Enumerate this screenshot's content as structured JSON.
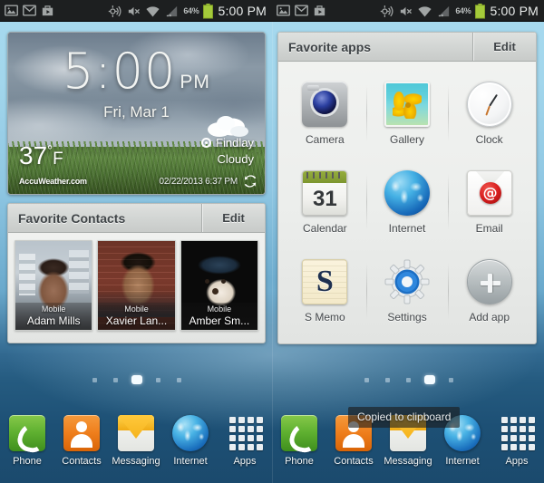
{
  "statusbar": {
    "icons": [
      "image-icon",
      "gmail-icon",
      "play-store-icon"
    ],
    "right_icons": [
      "nfc-icon",
      "mute-icon",
      "wifi-icon",
      "signal-icon"
    ],
    "battery_percent": "64%",
    "clock": "5:00 PM"
  },
  "weather_widget": {
    "time": "5:00",
    "ampm": "PM",
    "date": "Fri, Mar 1",
    "temperature": "37",
    "degree": "°",
    "unit": "F",
    "provider": "AccuWeather.com",
    "city": "Findlay",
    "condition": "Cloudy",
    "updated": "02/22/2013 6:37 PM",
    "refresh_icon": "refresh-icon",
    "location_icon": "gps-icon",
    "weather_icon": "cloud-icon"
  },
  "favorite_contacts": {
    "title": "Favorite Contacts",
    "edit_label": "Edit",
    "items": [
      {
        "type": "Mobile",
        "name": "Adam Mills"
      },
      {
        "type": "Mobile",
        "name": "Xavier Lan..."
      },
      {
        "type": "Mobile",
        "name": "Amber Sm..."
      }
    ]
  },
  "favorite_apps": {
    "title": "Favorite apps",
    "edit_label": "Edit",
    "rows": [
      [
        {
          "label": "Camera",
          "icon": "camera-icon"
        },
        {
          "label": "Gallery",
          "icon": "gallery-icon"
        },
        {
          "label": "Clock",
          "icon": "clock-icon"
        }
      ],
      [
        {
          "label": "Calendar",
          "icon": "calendar-icon",
          "badge": "31"
        },
        {
          "label": "Internet",
          "icon": "globe-icon"
        },
        {
          "label": "Email",
          "icon": "email-icon",
          "glyph": "@"
        }
      ],
      [
        {
          "label": "S Memo",
          "icon": "s-memo-icon"
        },
        {
          "label": "Settings",
          "icon": "gear-icon"
        },
        {
          "label": "Add app",
          "icon": "plus-icon"
        }
      ]
    ]
  },
  "page_indicator": {
    "left": {
      "count": 5,
      "active": 3
    },
    "right": {
      "count": 5,
      "active": 4
    }
  },
  "dock": {
    "items": [
      {
        "label": "Phone",
        "icon": "phone-icon"
      },
      {
        "label": "Contacts",
        "icon": "contacts-icon"
      },
      {
        "label": "Messaging",
        "icon": "messaging-icon"
      },
      {
        "label": "Internet",
        "icon": "browser-icon"
      },
      {
        "label": "Apps",
        "icon": "apps-grid-icon"
      }
    ]
  },
  "toast": {
    "message": "Copied to clipboard"
  },
  "colors": {
    "statusbar_bg": "#1d1f20",
    "battery_green": "#a4ca3a",
    "wallpaper_top": "#a8dbef",
    "wallpaper_bottom": "#1b4a6d",
    "panel_bg": "#eceeec",
    "accent_blue": "#1668b8"
  }
}
